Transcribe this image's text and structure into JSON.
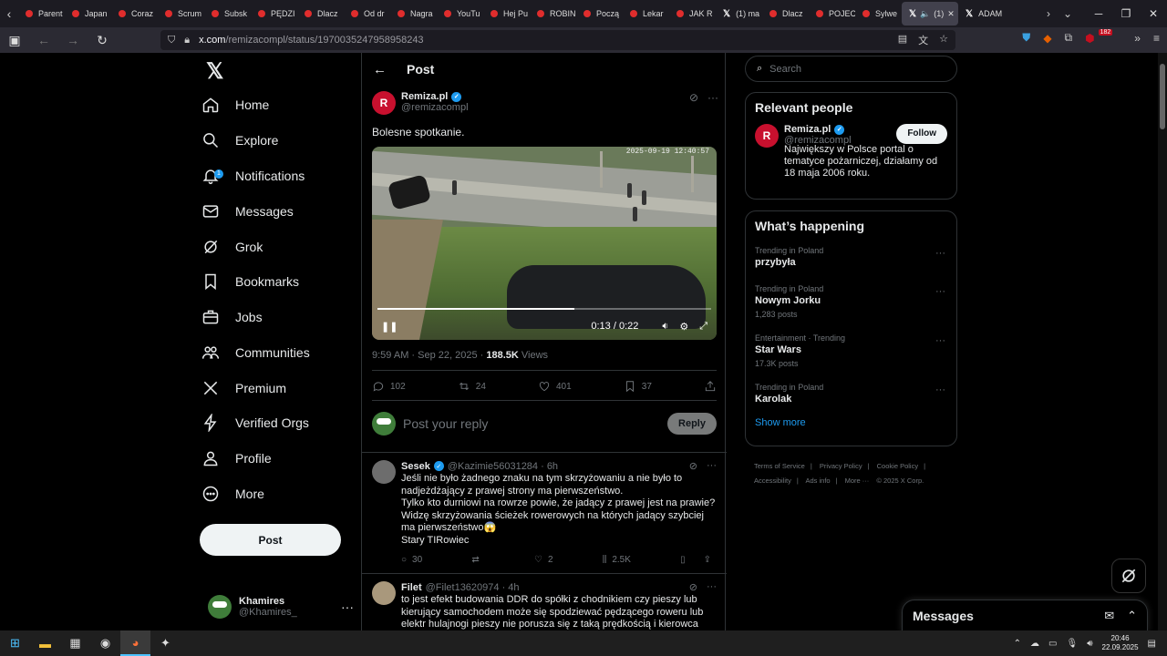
{
  "browser": {
    "tabs": [
      {
        "label": "Parent",
        "icon": "yt"
      },
      {
        "label": "Japan",
        "icon": "yt"
      },
      {
        "label": "Coraz",
        "icon": "yt"
      },
      {
        "label": "Scrum",
        "icon": "yt"
      },
      {
        "label": "Subsk",
        "icon": "yt"
      },
      {
        "label": "PĘDZI",
        "icon": "yt"
      },
      {
        "label": "Dlacz",
        "icon": "yt"
      },
      {
        "label": "Od dr",
        "icon": "yt"
      },
      {
        "label": "Nagra",
        "icon": "yt"
      },
      {
        "label": "YouTu",
        "icon": "yt"
      },
      {
        "label": "Hej Pu",
        "icon": "yt"
      },
      {
        "label": "ROBIN",
        "icon": "yt"
      },
      {
        "label": "Począ",
        "icon": "yt"
      },
      {
        "label": "Lekar",
        "icon": "yt"
      },
      {
        "label": "JAK R",
        "icon": "yt"
      },
      {
        "label": "(1) ma",
        "icon": "x"
      },
      {
        "label": "Dlacz",
        "icon": "yt"
      },
      {
        "label": "POJEC",
        "icon": "yt"
      },
      {
        "label": "Sylwe",
        "icon": "yt"
      },
      {
        "label": "(1)",
        "icon": "x",
        "active": true
      },
      {
        "label": "ADAM",
        "icon": "x"
      }
    ],
    "url_host": "x.com",
    "url_path": "/remizacompl/status/1970035247958958243",
    "ext_badge": "182"
  },
  "nav": {
    "home": "Home",
    "explore": "Explore",
    "notifications": "Notifications",
    "notifications_count": "1",
    "messages": "Messages",
    "grok": "Grok",
    "bookmarks": "Bookmarks",
    "jobs": "Jobs",
    "communities": "Communities",
    "premium": "Premium",
    "verified_orgs": "Verified Orgs",
    "profile": "Profile",
    "more": "More",
    "post_button": "Post",
    "me_name": "Khamires",
    "me_handle": "@Khamires_"
  },
  "post": {
    "header": "Post",
    "author_name": "Remiza.pl",
    "author_handle": "@remizacompl",
    "text": "Bolesne spotkanie.",
    "video_timestamp": "2025-09-19 12:40:57",
    "video_time": "0:13 / 0:22",
    "video_progress_pct": 59,
    "time": "9:59 AM · Sep 22, 2025 · ",
    "views": "188.5K",
    "views_label": " Views",
    "replies": "102",
    "reposts": "24",
    "likes": "401",
    "bookmarks": "37",
    "reply_placeholder": "Post your reply",
    "reply_button": "Reply"
  },
  "comments": [
    {
      "name": "Sesek",
      "handle": "@Kazimie56031284 · 6h",
      "body": "Jeśli nie było żadnego znaku na tym skrzyżowaniu a nie było to nadjeżdżający z prawej strony ma pierwszeństwo.\nTylko kto durniowi na rowrze powie, że jadący z prawej jest na prawie?\nWidzę skrzyżowania ścieżek rowerowych na których jadący szybciej ma pierwszeństwo😱\nStary TIRowiec",
      "replies": "30",
      "reposts": "",
      "likes": "2",
      "views": "2.5K"
    },
    {
      "name": "Filet",
      "handle": "@Filet13620974 · 4h",
      "body": "to jest efekt budowania DDR do spółki z chodnikiem czy pieszy lub kierujący samochodem może się spodziewać pędzącego roweru lub elektr hulajnogi pieszy nie porusza się z taką prędkością i kierowca może go"
    }
  ],
  "right": {
    "search_placeholder": "Search",
    "relevant_title": "Relevant people",
    "rp_name": "Remiza.pl",
    "rp_handle": "@remizacompl",
    "follow": "Follow",
    "rp_bio": "Największy w Polsce portal o tematyce pożarniczej, działamy od 18 maja 2006 roku.",
    "happening_title": "What’s happening",
    "trends": [
      {
        "context": "Trending in Poland",
        "name": "przybyła",
        "count": ""
      },
      {
        "context": "Trending in Poland",
        "name": "Nowym Jorku",
        "count": "1,283 posts"
      },
      {
        "context": "Entertainment · Trending",
        "name": "Star Wars",
        "count": "17.3K posts"
      },
      {
        "context": "Trending in Poland",
        "name": "Karolak",
        "count": ""
      }
    ],
    "show_more": "Show more",
    "footer": [
      "Terms of Service",
      "|",
      "Privacy Policy",
      "|",
      "Cookie Policy",
      "|",
      "Accessibility",
      "|",
      "Ads info",
      "|",
      "More ···",
      "© 2025 X Corp."
    ]
  },
  "drawer": {
    "messages": "Messages"
  },
  "taskbar": {
    "time": "20:46",
    "date": "22.09.2025"
  },
  "colors": {
    "accent": "#1d9bf0",
    "background": "#000000",
    "muted": "#71767b",
    "remiza": "#c8102e"
  }
}
